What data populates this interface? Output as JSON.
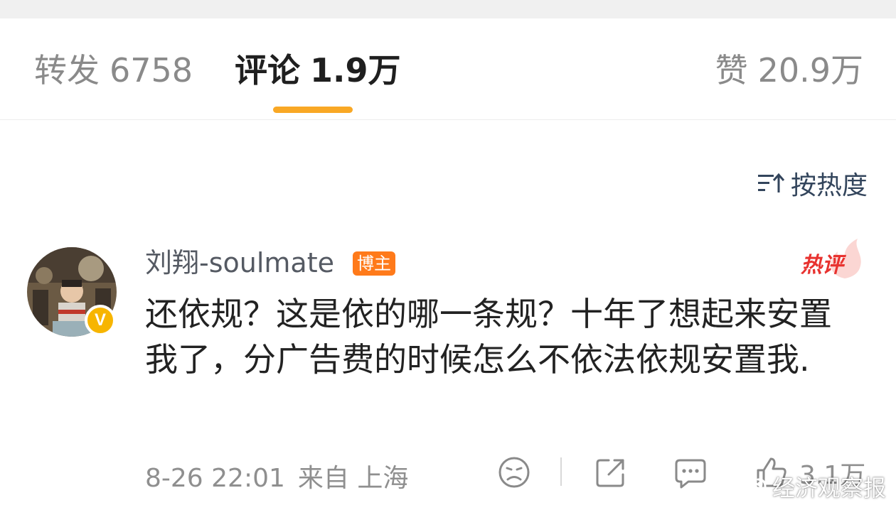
{
  "tabs": {
    "repost": {
      "label": "转发",
      "count": "6758"
    },
    "comments": {
      "label": "评论",
      "count": "1.9万"
    },
    "likes": {
      "label": "赞",
      "count": "20.9万"
    }
  },
  "sort": {
    "label": "按热度",
    "icon": "sort-icon"
  },
  "comment": {
    "username": "刘翔-soulmate",
    "author_badge": "博主",
    "verified_badge": "V",
    "hot_tag": "热评",
    "text": "还依规？这是依的哪一条规？十年了想起来安置我了，分广告费的时候怎么不依法依规安置我.",
    "time": "8-26 22:01",
    "location": "来自 上海",
    "like_count": "3.1万",
    "icons": [
      "dislike-face-icon",
      "share-icon",
      "comment-icon",
      "thumbs-up-icon"
    ]
  },
  "watermark": {
    "text": "经济观察报"
  },
  "colors": {
    "accent": "#f9a825",
    "author_badge": "#ff7a1a",
    "hot": "#e8322f",
    "verified": "#f7b500"
  }
}
